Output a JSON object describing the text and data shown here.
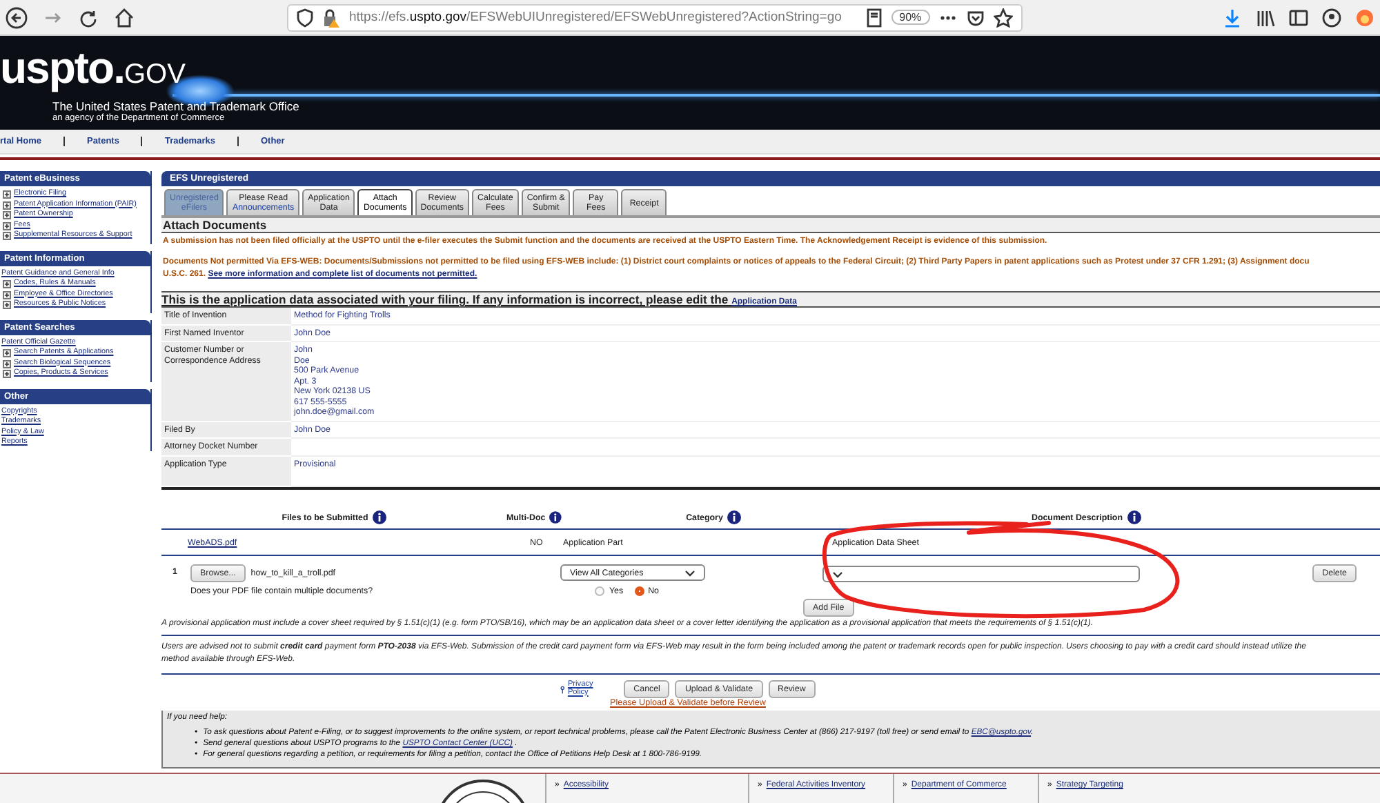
{
  "browser": {
    "url": "https://efs.**uspto.gov**/EFSWebUIUnregistered/EFSWebUnregistered?ActionString=go",
    "zoom": "90%"
  },
  "banner": {
    "logo": [
      "uspto.",
      "GOV"
    ],
    "subtitle": "The United States Patent and Trademark Office",
    "tagline": "an agency of the Department of Commerce"
  },
  "nav": [
    "rtal Home",
    "Patents",
    "Trademarks",
    "Other"
  ],
  "sidebar": [
    {
      "title": "Patent eBusiness",
      "items": [
        {
          "label": "Electronic Filing",
          "expandable": true
        },
        {
          "label": "Patent Application Information (PAIR)",
          "expandable": true
        },
        {
          "label": "Patent Ownership",
          "expandable": true
        },
        {
          "label": "Fees",
          "expandable": true
        },
        {
          "label": "Supplemental Resources & Support",
          "expandable": true
        }
      ]
    },
    {
      "title": "Patent Information",
      "items": [
        {
          "label": "Patent Guidance and General Info",
          "expandable": false
        },
        {
          "label": "Codes, Rules & Manuals",
          "expandable": true
        },
        {
          "label": "Employee & Office Directories",
          "expandable": true
        },
        {
          "label": "Resources & Public Notices",
          "expandable": true
        }
      ]
    },
    {
      "title": "Patent Searches",
      "items": [
        {
          "label": "Patent Official Gazette",
          "expandable": false
        },
        {
          "label": "Search Patents & Applications",
          "expandable": true
        },
        {
          "label": "Search Biological Sequences",
          "expandable": true
        },
        {
          "label": "Copies, Products & Services",
          "expandable": true
        }
      ]
    },
    {
      "title": "Other",
      "items": [
        {
          "label": "Copyrights",
          "expandable": false
        },
        {
          "label": "Trademarks",
          "expandable": false
        },
        {
          "label": "Policy & Law",
          "expandable": false
        },
        {
          "label": "Reports",
          "expandable": false
        }
      ]
    }
  ],
  "main": {
    "panel_title": "EFS Unregistered",
    "tabs": [
      {
        "lines": [
          "Unregistered",
          "eFilers"
        ],
        "selected": false,
        "disabled": true,
        "kind": "plain"
      },
      {
        "lines": [
          "Please Read",
          "Announcements"
        ],
        "selected": false,
        "disabled": false,
        "kind": "link"
      },
      {
        "lines": [
          "Application",
          "Data"
        ],
        "selected": false,
        "disabled": false,
        "kind": "plain"
      },
      {
        "lines": [
          "Attach",
          "Documents"
        ],
        "selected": true,
        "disabled": false,
        "kind": "plain"
      },
      {
        "lines": [
          "Review",
          "Documents"
        ],
        "selected": false,
        "disabled": false,
        "kind": "plain"
      },
      {
        "lines": [
          "Calculate",
          "Fees"
        ],
        "selected": false,
        "disabled": false,
        "kind": "plain"
      },
      {
        "lines": [
          "Confirm &",
          "Submit"
        ],
        "selected": false,
        "disabled": false,
        "kind": "plain"
      },
      {
        "lines": [
          "Pay",
          "Fees"
        ],
        "selected": false,
        "disabled": false,
        "kind": "plain"
      },
      {
        "lines": [
          "Receipt"
        ],
        "selected": false,
        "disabled": false,
        "kind": "plain"
      }
    ],
    "section_title": "Attach Documents",
    "notice": "A submission has not been filed officially at the USPTO until the e-filer executes the Submit function and the documents are received at the USPTO Eastern Time. The Acknowledgement Receipt is evidence of this submission.",
    "not_permitted": "Documents Not permitted Via EFS-WEB: Documents/Submissions not permitted to be filed using EFS-WEB include: (1) District court complaints or notices of appeals to the Federal Circuit; (2) Third Party Papers in patent applications such as Protest under 37 CFR 1.291; (3) Assignment docu",
    "not_permitted_2": "U.S.C. 261.",
    "not_permitted_link": "See more information and complete list of documents not permitted.",
    "app_heading": "This is the application data associated with your filing. If any information is incorrect, please edit the",
    "app_heading_link": "Application Data",
    "app_rows": [
      {
        "label": "Title of Invention",
        "value": [
          "Method for Fighting Trolls"
        ]
      },
      {
        "label": "First Named Inventor",
        "value": [
          "John Doe"
        ]
      },
      {
        "label": "Customer Number or Correspondence Address",
        "value": [
          "John",
          "Doe",
          "500 Park Avenue",
          "Apt. 3",
          "New York 02138 US",
          "617 555-5555",
          "john.doe@gmail.com"
        ]
      },
      {
        "label": "Filed By",
        "value": [
          "John Doe"
        ]
      },
      {
        "label": "Attorney Docket Number",
        "value": []
      },
      {
        "label": "Application Type",
        "value": [
          "Provisional"
        ]
      }
    ],
    "file_columns": [
      "Files to be Submitted",
      "Multi-Doc",
      "Category",
      "Document Description"
    ],
    "existing_file": {
      "file": "WebADS.pdf",
      "multi_doc": "NO",
      "category": "Application Part",
      "description": "Application Data Sheet"
    },
    "upload": {
      "number": "1",
      "browse": "Browse...",
      "file": "how_to_kill_a_troll.pdf",
      "question": "Does your PDF file contain multiple documents?",
      "category": "View All Categories",
      "options": [
        {
          "label": "Yes",
          "selected": false
        },
        {
          "label": "No",
          "selected": true
        }
      ],
      "delete": "Delete",
      "add": "Add File"
    },
    "provisional_note": "A provisional application must include a cover sheet required by § 1.51(c)(1) (e.g. form PTO/SB/16), which may be an application data sheet or a cover letter identifying the application as a provisional application that meets the requirements of § 1.51(c)(1).",
    "credit_note": "Users are advised not to submit **credit card** payment form **PTO-2038** via EFS-Web. Submission of the credit card payment form via EFS-Web may result in the form being included among the patent or trademark records open for public inspection. Users choosing to pay with a credit card should instead utilize the",
    "credit_note_2": "method available through EFS-Web.",
    "privacy": "Privacy Policy",
    "buttons": [
      "Cancel",
      "Upload & Validate",
      "Review"
    ],
    "hint": "Please Upload & Validate before Review"
  },
  "help": {
    "title": "If you need help:",
    "bullets": [
      {
        "text": "To ask questions about Patent e-Filing, or to suggest improvements to the online system, or report technical problems, please call the Patent Electronic Business Center at (866) 217-9197 (toll free) or send email to ",
        "link": "EBC@uspto.gov",
        "after": "."
      },
      {
        "text": "Send general questions about USPTO programs to the ",
        "link": "USPTO Contact Center (UCC)",
        "after": " ."
      },
      {
        "text": "For general questions regarding a petition, or requirements for filing a petition, contact the Office of Petitions Help Desk at 1 800-786-9199."
      }
    ],
    "marker": "•"
  },
  "footer": [
    {
      "marker": "»",
      "label": "Accessibility"
    },
    {
      "marker": "»",
      "label": "Federal Activities Inventory"
    },
    {
      "marker": "»",
      "label": "Department of Commerce"
    },
    {
      "marker": "»",
      "label": "Strategy Targeting"
    }
  ]
}
